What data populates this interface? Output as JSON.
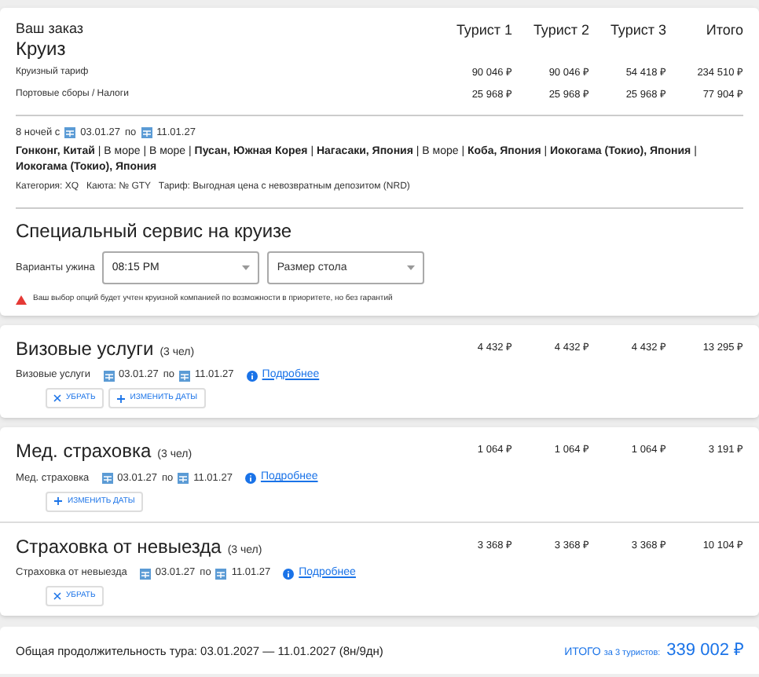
{
  "order": {
    "title": "Ваш заказ",
    "subtitle": "Круиз",
    "columns": [
      "Турист 1",
      "Турист 2",
      "Турист 3",
      "Итого"
    ],
    "rows": [
      {
        "label": "Круизный тариф",
        "values": [
          "90 046 ₽",
          "90 046 ₽",
          "54 418 ₽",
          "234 510 ₽"
        ]
      },
      {
        "label": "Портовые сборы / Налоги",
        "values": [
          "25 968 ₽",
          "25 968 ₽",
          "25 968 ₽",
          "77 904 ₽"
        ]
      }
    ],
    "nights": "8 ночей с",
    "date_from": "03.01.27",
    "date_sep": "по",
    "date_to": "11.01.27",
    "route": "**Гонконг, Китай** | В море | В море | **Пусан, Южная Корея** | **Нагасаки, Япония** | В море | **Коба, Япония** | **Иокогама (Токио), Япония** | **Иокогама (Токио), Япония**",
    "details": "Категория: XQ   Каюта: № GTY   Тариф: Выгодная цена с невозвратным депозитом (NRD)"
  },
  "special": {
    "title": "Специальный сервис на круизе",
    "label": "Варианты ужина",
    "dinner_time": "08:15 PM",
    "table_size": {
      "placeholder": "Размер стола"
    },
    "warning": "Ваш выбор опций будет учтен круизной компанией по возможности в приоритете, но без гарантий"
  },
  "service_cards": [
    {
      "services": [
        {
          "title": "Визовые услуги",
          "count": "(3 чел)",
          "values": [
            "4 432 ₽",
            "4 432 ₽",
            "4 432 ₽",
            "13 295 ₽"
          ],
          "sublabel": "Визовые услуги",
          "date_from": "03.01.27",
          "date_sep": "по",
          "date_to": "11.01.27",
          "link": "Подробнее",
          "buttons": [
            {
              "kind": "remove",
              "label": "УБРАТЬ"
            },
            {
              "kind": "add",
              "label": "ИЗМЕНИТЬ ДАТЫ"
            }
          ]
        }
      ]
    },
    {
      "services": [
        {
          "title": "Мед. страховка",
          "count": "(3 чел)",
          "values": [
            "1 064 ₽",
            "1 064 ₽",
            "1 064 ₽",
            "3 191 ₽"
          ],
          "sublabel": "Мед. страховка",
          "date_from": "03.01.27",
          "date_sep": "по",
          "date_to": "11.01.27",
          "link": "Подробнее",
          "buttons": [
            {
              "kind": "add",
              "label": "ИЗМЕНИТЬ ДАТЫ"
            }
          ]
        },
        {
          "title": "Страховка от невыезда",
          "count": "(3 чел)",
          "values": [
            "3 368 ₽",
            "3 368 ₽",
            "3 368 ₽",
            "10 104 ₽"
          ],
          "sublabel": "Страховка от невыезда",
          "date_from": "03.01.27",
          "date_sep": "по",
          "date_to": "11.01.27",
          "link": "Подробнее",
          "buttons": [
            {
              "kind": "remove",
              "label": "УБРАТЬ"
            }
          ]
        }
      ]
    }
  ],
  "footer": {
    "duration": "Общая продолжительность тура: 03.01.2027 — 11.01.2027 (8н/9дн)",
    "total_label": "ИТОГО",
    "total_for": "за 3 туристов:",
    "total": "339 002 ₽"
  }
}
